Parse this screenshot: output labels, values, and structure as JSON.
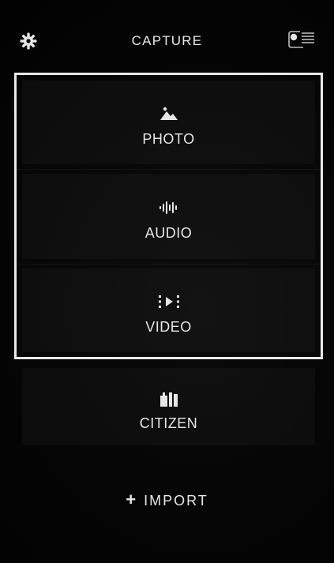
{
  "header": {
    "title": "CAPTURE",
    "left_icon": "gear-icon",
    "right_icon": "status-icon"
  },
  "options": [
    {
      "label": "PHOTO",
      "icon": "image-icon",
      "selected": true
    },
    {
      "label": "AUDIO",
      "icon": "waveform-icon",
      "selected": true
    },
    {
      "label": "VIDEO",
      "icon": "video-icon",
      "selected": true
    },
    {
      "label": "CITIZEN",
      "icon": "citizen-icon",
      "selected": false
    }
  ],
  "import": {
    "label": "IMPORT",
    "icon": "plus-icon"
  },
  "colors": {
    "background": "#000000",
    "foreground": "#e6e6e6",
    "frame": "#e9e9e9"
  }
}
